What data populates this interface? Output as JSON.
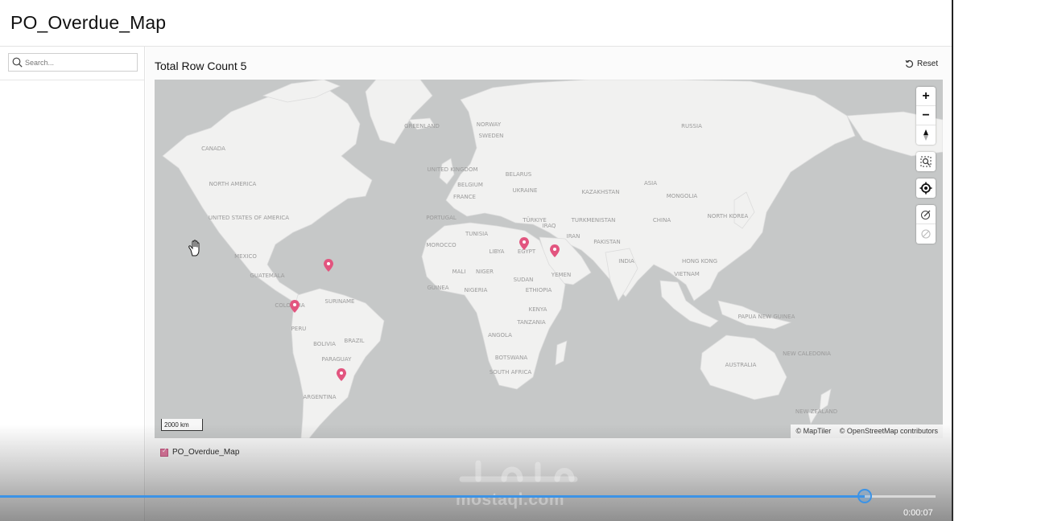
{
  "title": "PO_Overdue_Map",
  "search": {
    "placeholder": "Search..."
  },
  "header": {
    "row_count_label": "Total Row Count 5",
    "reset_label": "Reset"
  },
  "map": {
    "scale_label": "2000 km",
    "attribution": [
      "© MapTiler",
      "© OpenStreetMap contributors"
    ],
    "controls": [
      "zoom-in",
      "zoom-out",
      "compass",
      "zoom-to-fit",
      "locate",
      "draw",
      "clear"
    ],
    "labels": {
      "greenland": "GREENLAND",
      "norway": "NORWAY",
      "sweden": "SWEDEN",
      "russia": "RUSSIA",
      "canada": "CANADA",
      "north_america": "NORTH AMERICA",
      "united_kingdom": "UNITED KINGDOM",
      "belgium": "BELGIUM",
      "belarus": "BELARUS",
      "ukraine": "UKRAINE",
      "france": "FRANCE",
      "kazakhstan": "KAZAKHSTAN",
      "asia": "ASIA",
      "mongolia": "MONGOLIA",
      "united_states": "UNITED STATES OF AMERICA",
      "portugal": "PORTUGAL",
      "turkiye": "TÜRKIYE",
      "turkmenistan": "TURKMENISTAN",
      "china": "CHINA",
      "north_korea": "NORTH KOREA",
      "morocco": "MOROCCO",
      "tunisia": "TUNISIA",
      "iraq": "IRAQ",
      "iran": "IRAN",
      "pakistan": "PAKISTAN",
      "libya": "LIBYA",
      "egypt": "EGYPT",
      "mexico": "MEXICO",
      "india": "INDIA",
      "hong_kong": "HONG KONG",
      "mali": "MALI",
      "niger": "NIGER",
      "sudan": "SUDAN",
      "yemen": "YEMEN",
      "guatemala": "GUATEMALA",
      "vietnam": "VIETNAM",
      "guinea": "GUINEA",
      "nigeria": "NIGERIA",
      "ethiopia": "ETHIOPIA",
      "suriname": "SURINAME",
      "colombia": "COLOMBIA",
      "kenya": "KENYA",
      "peru": "PERU",
      "brazil": "BRAZIL",
      "tanzania": "TANZANIA",
      "papua_new_guinea": "PAPUA NEW GUINEA",
      "bolivia": "BOLIVIA",
      "angola": "ANGOLA",
      "paraguay": "PARAGUAY",
      "botswana": "BOTSWANA",
      "australia": "AUSTRALIA",
      "new_caledonia": "NEW CALEDONIA",
      "south_africa": "SOUTH AFRICA",
      "argentina": "ARGENTINA",
      "new_zealand": "NEW ZEALAND"
    },
    "marker_color": "#e2557f"
  },
  "legend": {
    "label": "PO_Overdue_Map",
    "color": "#e2739d"
  },
  "video": {
    "timecode": "0:00:07",
    "progress": 0.924,
    "watermark": "mostaql.com"
  },
  "colors": {
    "land": "#f1f1f0",
    "water": "#c6c8c8",
    "accent": "#3c93e6"
  }
}
